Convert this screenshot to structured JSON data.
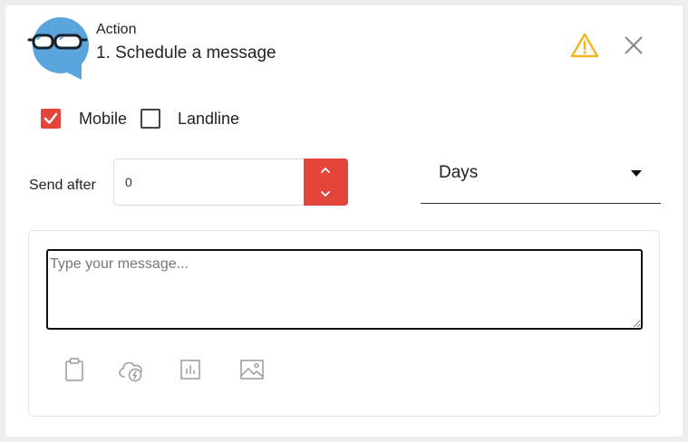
{
  "header": {
    "label": "Action",
    "title": "1. Schedule a message"
  },
  "icons": {
    "avatar": "glasses-speech-bubble-icon",
    "warning": "warning-triangle-icon",
    "close": "close-icon",
    "stepper_up": "chevron-up-icon",
    "stepper_down": "chevron-down-icon",
    "dropdown": "caret-down-icon",
    "toolbar": [
      "clipboard-icon",
      "cloud-bolt-icon",
      "bar-chart-icon",
      "image-icon"
    ]
  },
  "channels": [
    {
      "label": "Mobile",
      "checked": true
    },
    {
      "label": "Landline",
      "checked": false
    }
  ],
  "send_after": {
    "label": "Send after",
    "value": "0",
    "unit": "Days"
  },
  "message": {
    "placeholder": "Type your message...",
    "value": ""
  },
  "colors": {
    "accent": "#e2453a",
    "avatar_blue": "#5aa5dd",
    "warning": "#f2b824"
  }
}
